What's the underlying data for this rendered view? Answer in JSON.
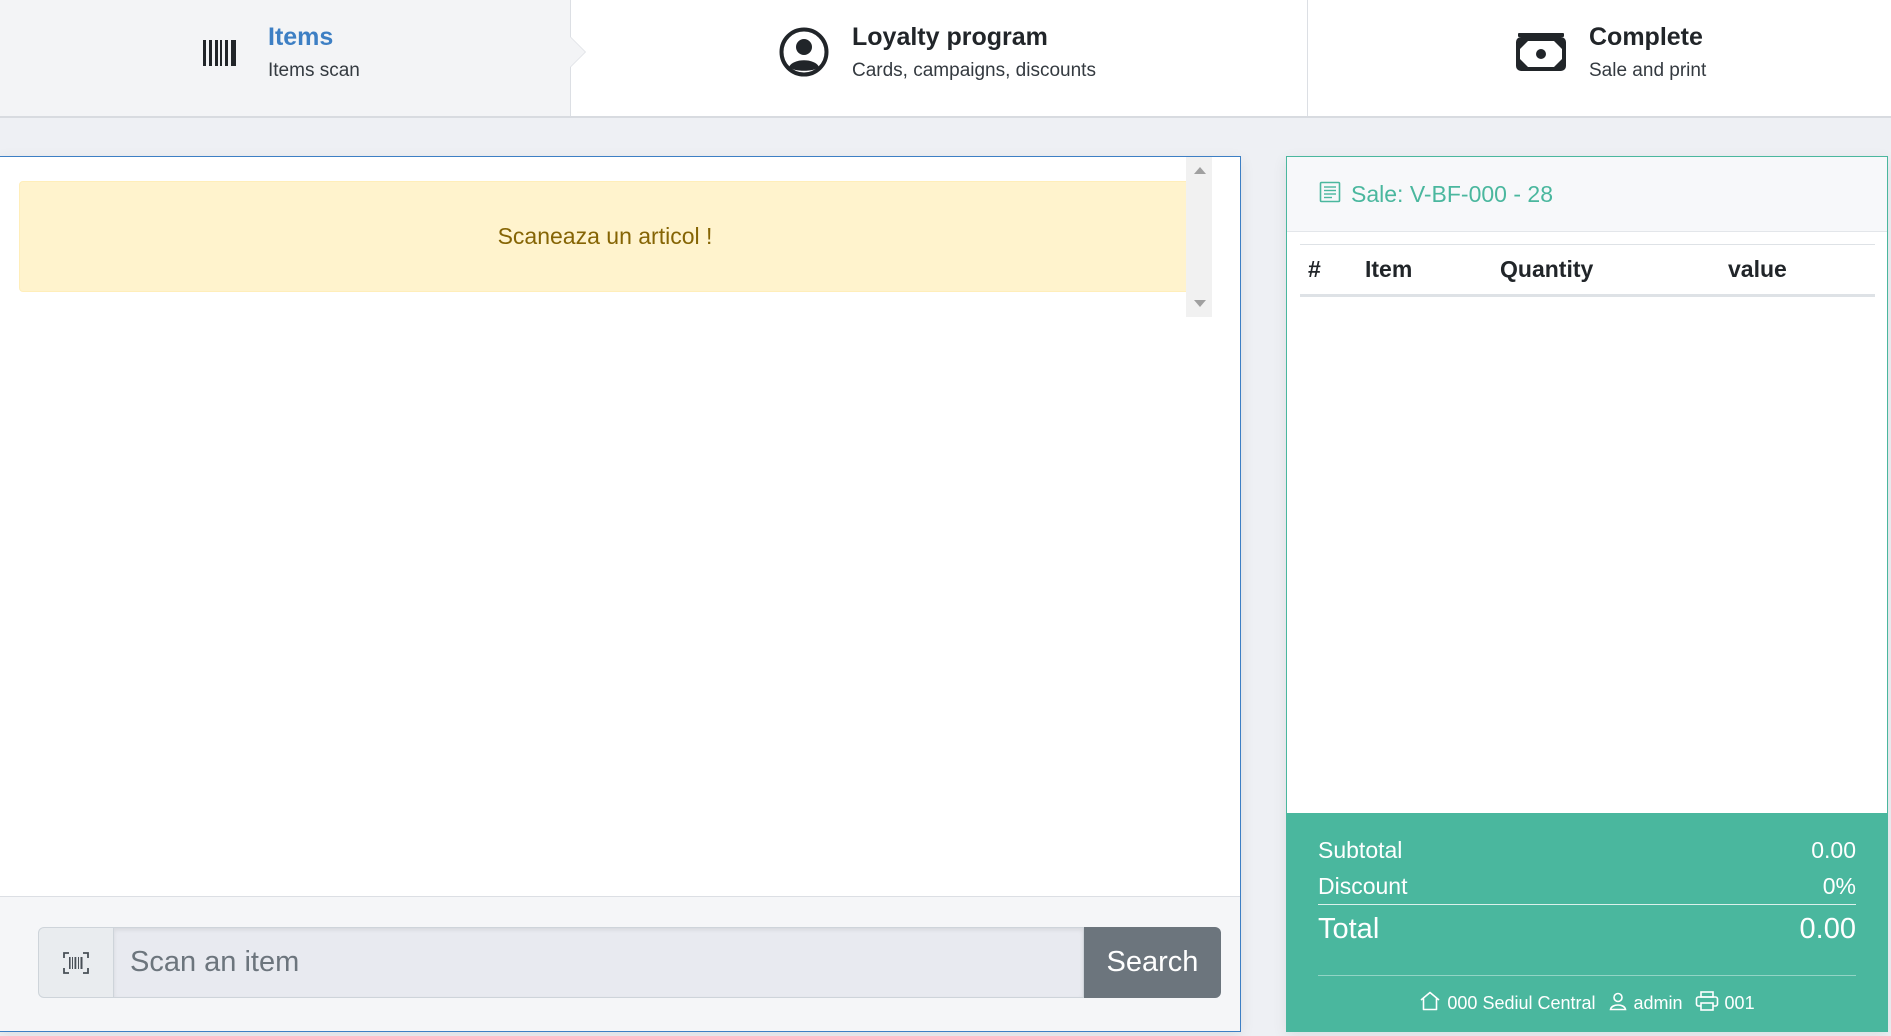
{
  "steps": [
    {
      "title": "Items",
      "subtitle": "Items scan",
      "icon": "barcode-icon",
      "active": true
    },
    {
      "title": "Loyalty program",
      "subtitle": "Cards, campaigns, discounts",
      "icon": "user-circle-icon",
      "active": false
    },
    {
      "title": "Complete",
      "subtitle": "Sale and print",
      "icon": "cash-icon",
      "active": false
    }
  ],
  "scan": {
    "alert": "Scaneaza un articol !",
    "input_placeholder": "Scan an item",
    "input_value": "",
    "search_label": "Search"
  },
  "sale": {
    "title": "Sale:  V-BF-000 - 28",
    "columns": [
      "#",
      "Item",
      "Quantity",
      "value"
    ],
    "rows": [],
    "subtotal_label": "Subtotal",
    "subtotal_value": "0.00",
    "discount_label": "Discount",
    "discount_value": "0%",
    "total_label": "Total",
    "total_value": "0.00",
    "store": "000 Sediul Central",
    "user": "admin",
    "register": "001"
  },
  "colors": {
    "accent": "#3d7fc4",
    "sale_green": "#4ab79e",
    "alert_bg": "#fff3cd",
    "alert_text": "#856404",
    "button_gray": "#6c757d"
  }
}
